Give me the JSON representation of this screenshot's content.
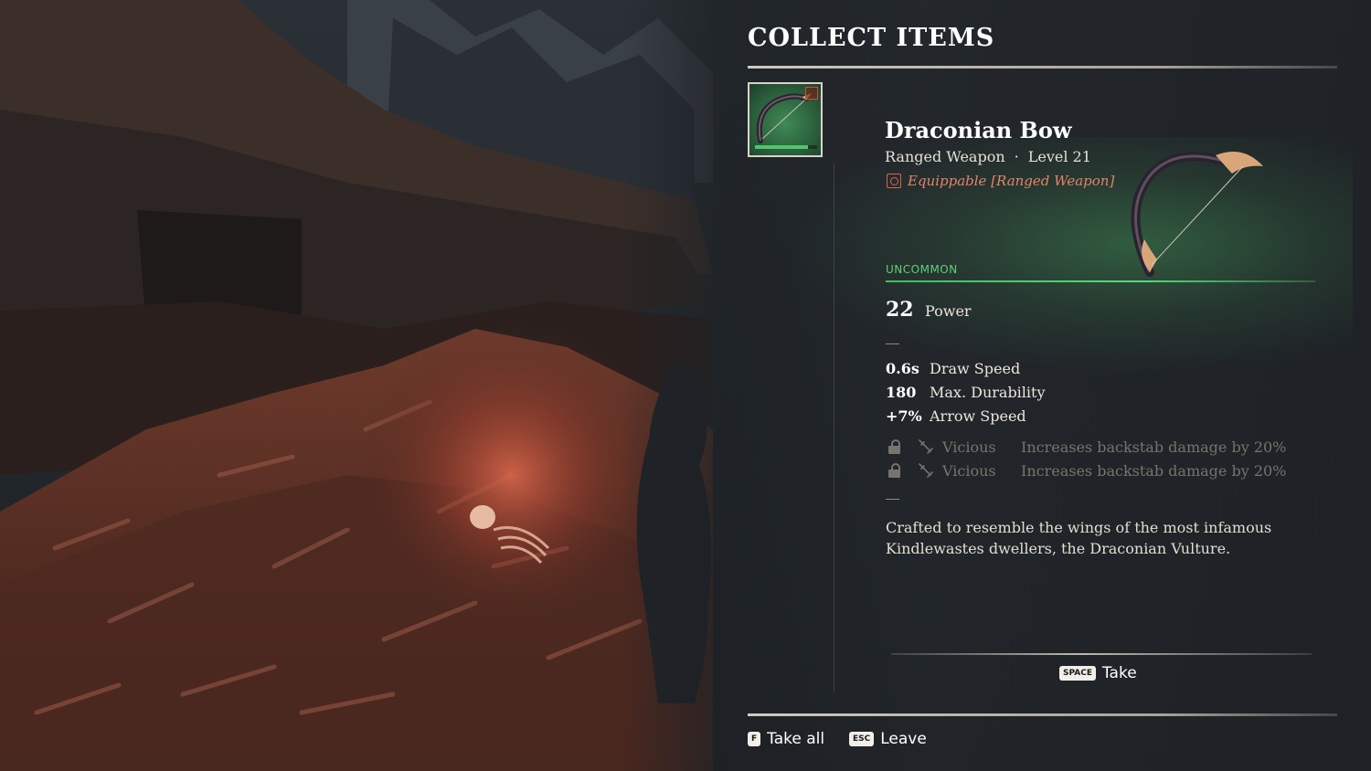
{
  "screen_title": "COLLECT ITEMS",
  "item": {
    "name": "Draconian Bow",
    "type": "Ranged Weapon",
    "level": "Level 21",
    "equippable": "Equippable [Ranged Weapon]",
    "rarity": "UNCOMMON",
    "rarity_color": "#5fcf78",
    "durability_fraction": 0.85,
    "power_value": "22",
    "power_label": "Power",
    "stats": [
      {
        "value": "0.6s",
        "name": "Draw Speed"
      },
      {
        "value": "180",
        "name": "Max. Durability"
      },
      {
        "value": "+7%",
        "name": "Arrow Speed"
      }
    ],
    "perks": [
      {
        "name": "Vicious",
        "effect": "Increases backstab damage by 20%",
        "locked": true
      },
      {
        "name": "Vicious",
        "effect": "Increases backstab damage by 20%",
        "locked": true
      }
    ],
    "description": "Crafted to resemble the wings of the most infamous Kindlewastes dwellers, the Draconian Vulture."
  },
  "actions": {
    "take": {
      "key": "SPACE",
      "label": "Take"
    },
    "take_all": {
      "key": "F",
      "label": "Take all"
    },
    "leave": {
      "key": "ESC",
      "label": "Leave"
    }
  },
  "icons": {
    "slot_badge": "equip-slot-icon",
    "lock": "lock-icon",
    "perk": "backstab-icon"
  }
}
